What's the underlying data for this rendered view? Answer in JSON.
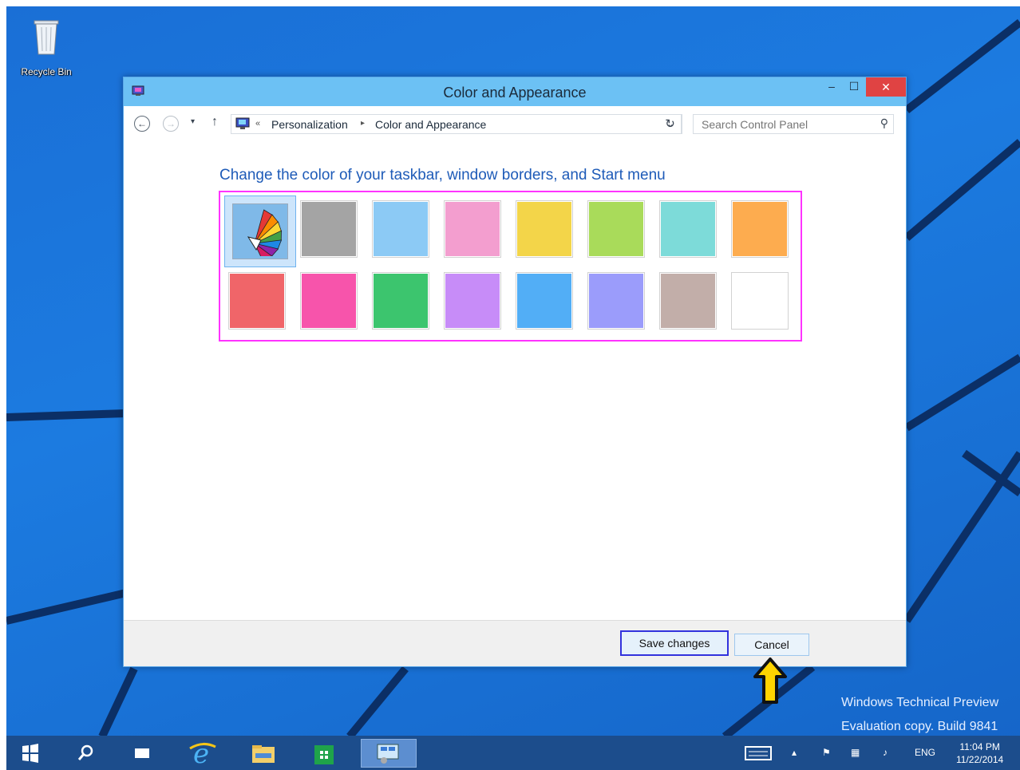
{
  "desktop": {
    "recycle_bin_label": "Recycle Bin",
    "watermark_line1": "Windows Technical Preview",
    "watermark_line2": "Evaluation copy. Build 9841"
  },
  "window": {
    "title": "Color and Appearance",
    "controls": {
      "minimize": "‒",
      "maximize": "☐",
      "close": "✕"
    },
    "address": {
      "prefix": "«",
      "crumbs": [
        "Personalization",
        "Color and Appearance"
      ],
      "search_placeholder": "Search Control Panel"
    },
    "heading": "Change the color of your taskbar, window borders, and Start menu",
    "swatches": [
      {
        "name": "automatic",
        "color": "#7fb9e8",
        "selected": true
      },
      {
        "name": "gray",
        "color": "#a4a4a4"
      },
      {
        "name": "light-blue",
        "color": "#8ccaf5"
      },
      {
        "name": "pink",
        "color": "#f39ecf"
      },
      {
        "name": "yellow",
        "color": "#f3d549"
      },
      {
        "name": "lime",
        "color": "#a9db5a"
      },
      {
        "name": "teal",
        "color": "#7ddbd9"
      },
      {
        "name": "orange",
        "color": "#fdac4f"
      },
      {
        "name": "red",
        "color": "#f06569"
      },
      {
        "name": "magenta",
        "color": "#f754ab"
      },
      {
        "name": "green",
        "color": "#3cc56e"
      },
      {
        "name": "purple",
        "color": "#c78cf8"
      },
      {
        "name": "blue",
        "color": "#52aef6"
      },
      {
        "name": "periwinkle",
        "color": "#9b9cfb"
      },
      {
        "name": "taupe",
        "color": "#c2aea9"
      },
      {
        "name": "white",
        "color": "#ffffff"
      }
    ],
    "buttons": {
      "save": "Save changes",
      "cancel": "Cancel"
    }
  },
  "taskbar": {
    "language": "ENG",
    "time": "11:04 PM",
    "date": "11/22/2014"
  },
  "colors": {
    "accent": "#1e5bb8",
    "titlebar": "#6cc1f4",
    "highlight_box": "#ff33ff",
    "taskbar": "#1c4d8c"
  }
}
